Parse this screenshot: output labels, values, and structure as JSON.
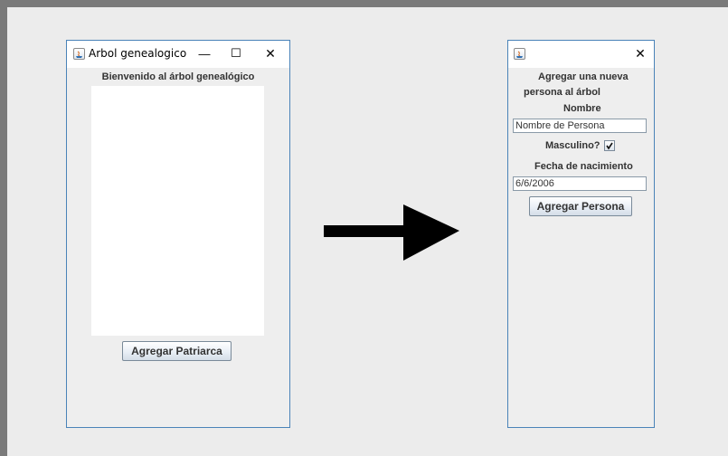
{
  "left_window": {
    "title": "Arbol genealogico",
    "controls": {
      "minimize": "—",
      "maximize": "☐",
      "close": "✕"
    },
    "heading": "Bienvenido al árbol genealógico",
    "add_patriarch_button": "Agregar Patriarca"
  },
  "right_window": {
    "controls": {
      "close": "✕"
    },
    "heading_line1": "Agregar una nueva",
    "heading_line2": "persona al árbol",
    "name_label": "Nombre",
    "name_field_value": "Nombre de Persona",
    "male_label": "Masculino?",
    "male_checked": true,
    "birthdate_label": "Fecha de nacimiento",
    "birthdate_value": "6/6/2006",
    "add_person_button": "Agregar Persona"
  },
  "colors": {
    "window_border": "#4a83b8",
    "arrow": "#000000",
    "background": "#ececec"
  }
}
